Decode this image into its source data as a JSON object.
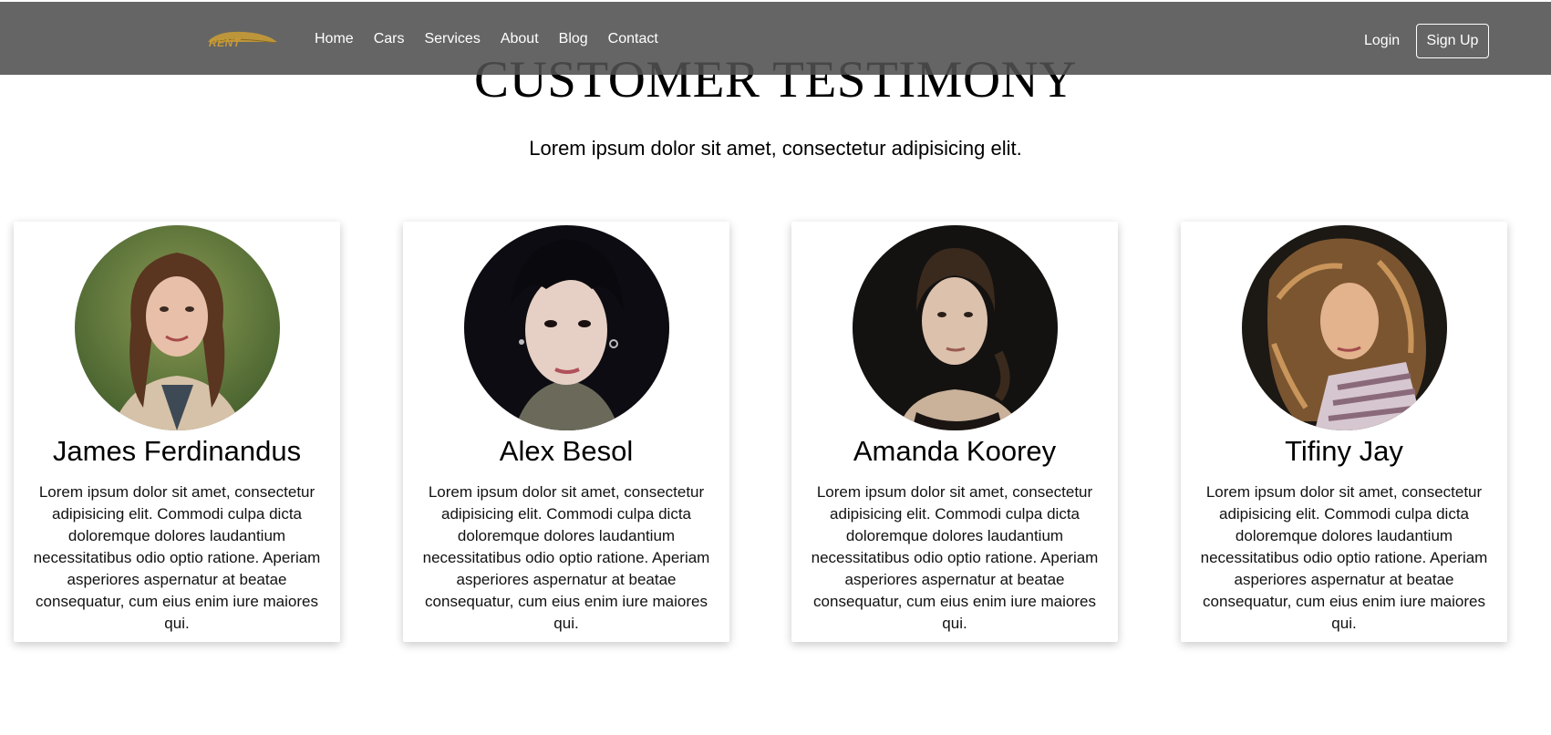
{
  "navbar": {
    "logo_text": "RENT",
    "links": [
      "Home",
      "Cars",
      "Services",
      "About",
      "Blog",
      "Contact"
    ],
    "login_label": "Login",
    "signup_label": "Sign Up"
  },
  "section": {
    "title": "CUSTOMER TESTIMONY",
    "subtitle": "Lorem ipsum dolor sit amet, consectetur adipisicing elit."
  },
  "testimonials": [
    {
      "name": "James Ferdinandus",
      "text": "Lorem ipsum dolor sit amet, consectetur adipisicing elit. Commodi culpa dicta doloremque dolores laudantium necessitatibus odio optio ratione. Aperiam asperiores aspernatur at beatae consequatur, cum eius enim iure maiores qui."
    },
    {
      "name": "Alex Besol",
      "text": "Lorem ipsum dolor sit amet, consectetur adipisicing elit. Commodi culpa dicta doloremque dolores laudantium necessitatibus odio optio ratione. Aperiam asperiores aspernatur at beatae consequatur, cum eius enim iure maiores qui."
    },
    {
      "name": "Amanda Koorey",
      "text": "Lorem ipsum dolor sit amet, consectetur adipisicing elit. Commodi culpa dicta doloremque dolores laudantium necessitatibus odio optio ratione. Aperiam asperiores aspernatur at beatae consequatur, cum eius enim iure maiores qui."
    },
    {
      "name": "Tifiny Jay",
      "text": "Lorem ipsum dolor sit amet, consectetur adipisicing elit. Commodi culpa dicta doloremque dolores laudantium necessitatibus odio optio ratione. Aperiam asperiores aspernatur at beatae consequatur, cum eius enim iure maiores qui."
    }
  ],
  "colors": {
    "navbar_bg": "#5a5a5a",
    "logo_gold": "#c79a36",
    "text": "#000000"
  }
}
